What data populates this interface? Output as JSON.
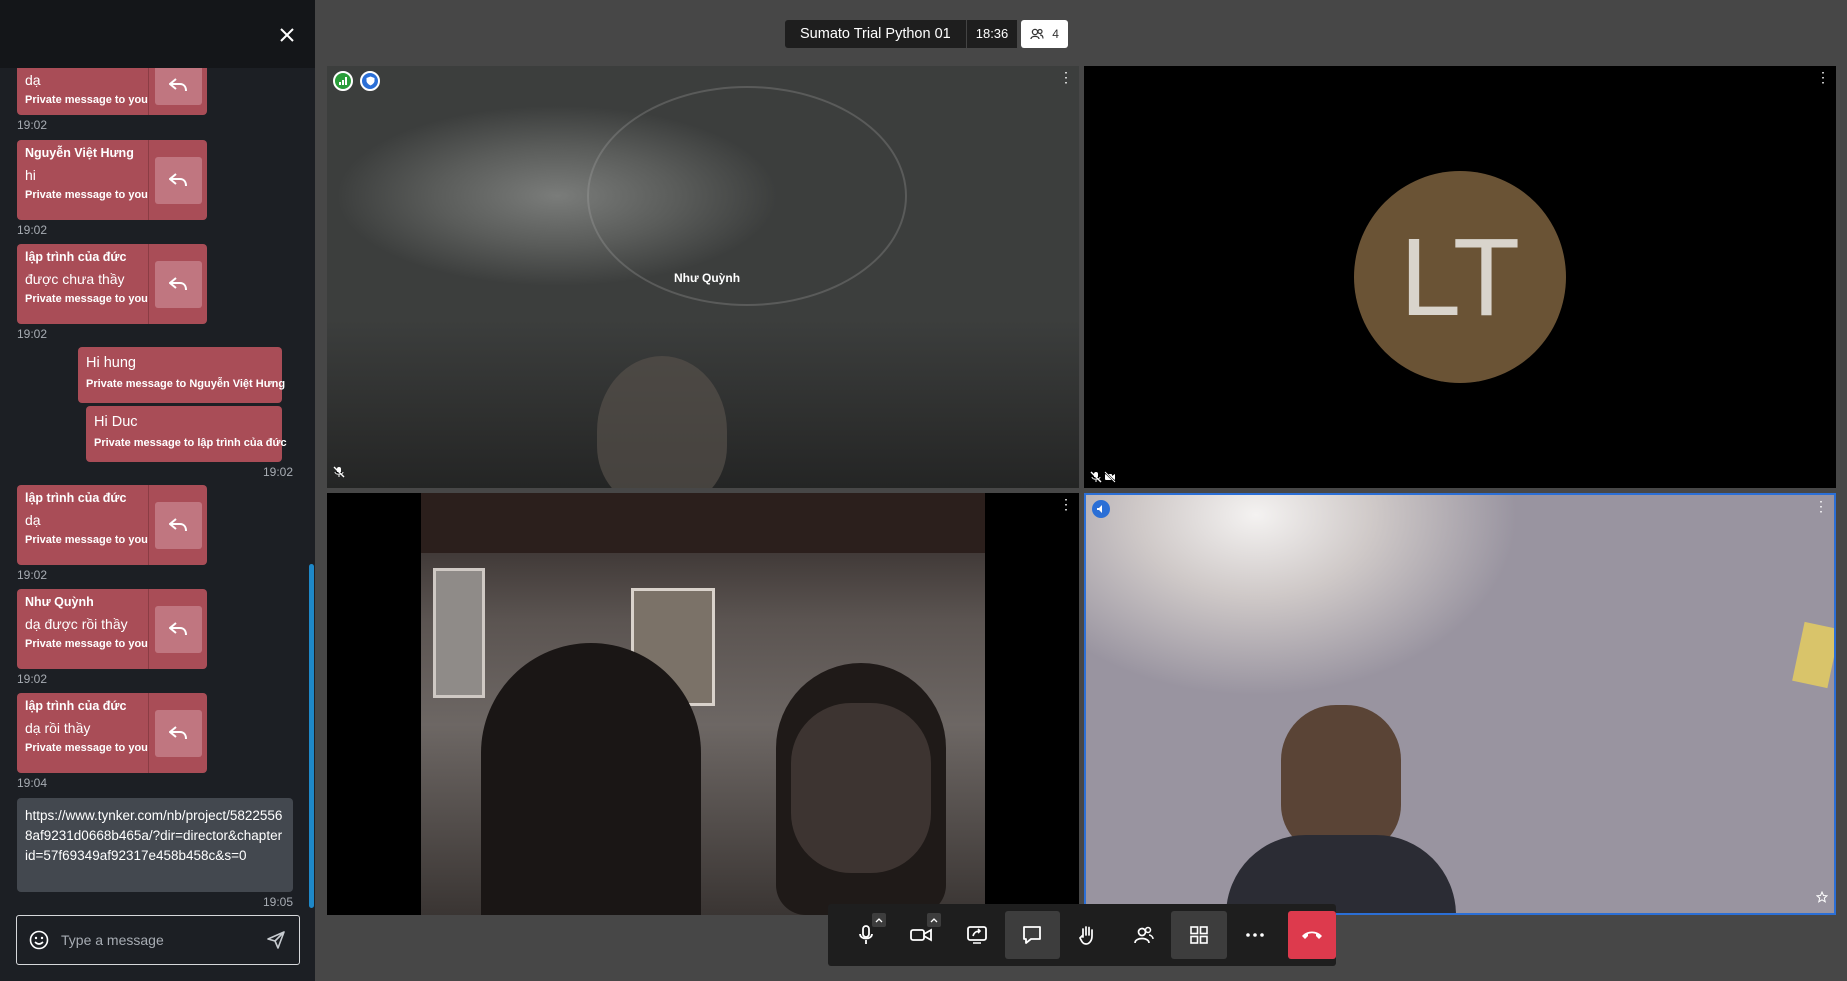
{
  "meeting": {
    "name": "Sumato Trial Python 01",
    "time": "18:36",
    "participant_count": "4"
  },
  "chat": {
    "placeholder": "Type a message",
    "messages": [
      {
        "sender": "",
        "text": "dạ",
        "note": "Private message to you",
        "time": "19:02"
      },
      {
        "sender": "Nguyễn Việt Hưng",
        "text": "hi",
        "note": "Private message to you",
        "time": "19:02"
      },
      {
        "sender": "lập trình của đức",
        "text": "được chưa thầy",
        "note": "Private message to you",
        "time": "19:02"
      },
      {
        "text": "Hi hung",
        "note": "Private message to Nguyễn Việt Hưng"
      },
      {
        "text": "Hi Duc",
        "note": "Private message to lập trình của đức",
        "time": "19:02"
      },
      {
        "sender": "lập trình của đức",
        "text": "dạ",
        "note": "Private message to you",
        "time": "19:02"
      },
      {
        "sender": "Như Quỳnh",
        "text": "dạ được rồi thầy",
        "note": "Private message to you",
        "time": "19:02"
      },
      {
        "sender": "lập trình của đức",
        "text": "dạ rồi thầy",
        "note": "Private message to you",
        "time": "19:04"
      },
      {
        "text": "https://www.tynker.com/nb/project/58225568af9231d0668b465a/?dir=director&chapterid=57f69349af92317e458b458c&s=0",
        "time": "19:05"
      }
    ]
  },
  "tiles": {
    "top_left": {
      "name": "Như Quỳnh"
    },
    "top_right": {
      "initials": "LT"
    }
  },
  "colors": {
    "accent": "#1e88c8",
    "message_bg": "#a94d57",
    "hangup": "#dd3a4d",
    "avatar": "#6a5335"
  },
  "icons": [
    "close-icon",
    "reply-icon",
    "emoji-icon",
    "send-icon",
    "microphone-icon",
    "camera-icon",
    "screen-share-icon",
    "chat-icon",
    "raise-hand-icon",
    "participants-icon",
    "tile-view-icon",
    "more-icon",
    "hangup-icon",
    "muted-mic-icon",
    "camera-off-icon",
    "star-icon"
  ]
}
